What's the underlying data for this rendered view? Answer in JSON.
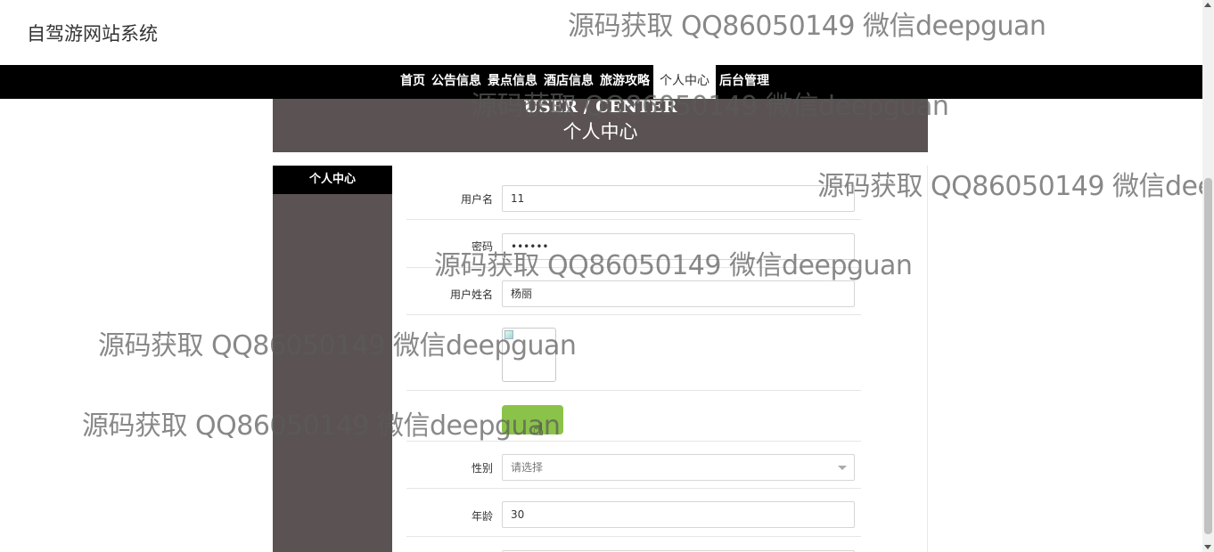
{
  "site": {
    "title": "自驾游网站系统"
  },
  "nav": {
    "items": [
      {
        "label": "首页"
      },
      {
        "label": "公告信息"
      },
      {
        "label": "景点信息"
      },
      {
        "label": "酒店信息"
      },
      {
        "label": "旅游攻略"
      },
      {
        "label": "个人中心",
        "active": true
      },
      {
        "label": "后台管理"
      }
    ]
  },
  "banner": {
    "en": "USER / CENTER",
    "cn": "个人中心"
  },
  "sidebar": {
    "heading": "个人中心"
  },
  "form": {
    "username": {
      "label": "用户名",
      "value": "11"
    },
    "password": {
      "label": "密码",
      "value": "••••••"
    },
    "fullname": {
      "label": "用户姓名",
      "value": "杨丽"
    },
    "gender": {
      "label": "性别",
      "placeholder": "请选择"
    },
    "age": {
      "label": "年龄",
      "value": "30"
    }
  },
  "watermark": {
    "text": "源码获取 QQ86050149 微信deepguan"
  },
  "colors": {
    "nav_bg": "#000000",
    "banner_bg": "#5b5253",
    "upload_button": "#8bc34a"
  }
}
